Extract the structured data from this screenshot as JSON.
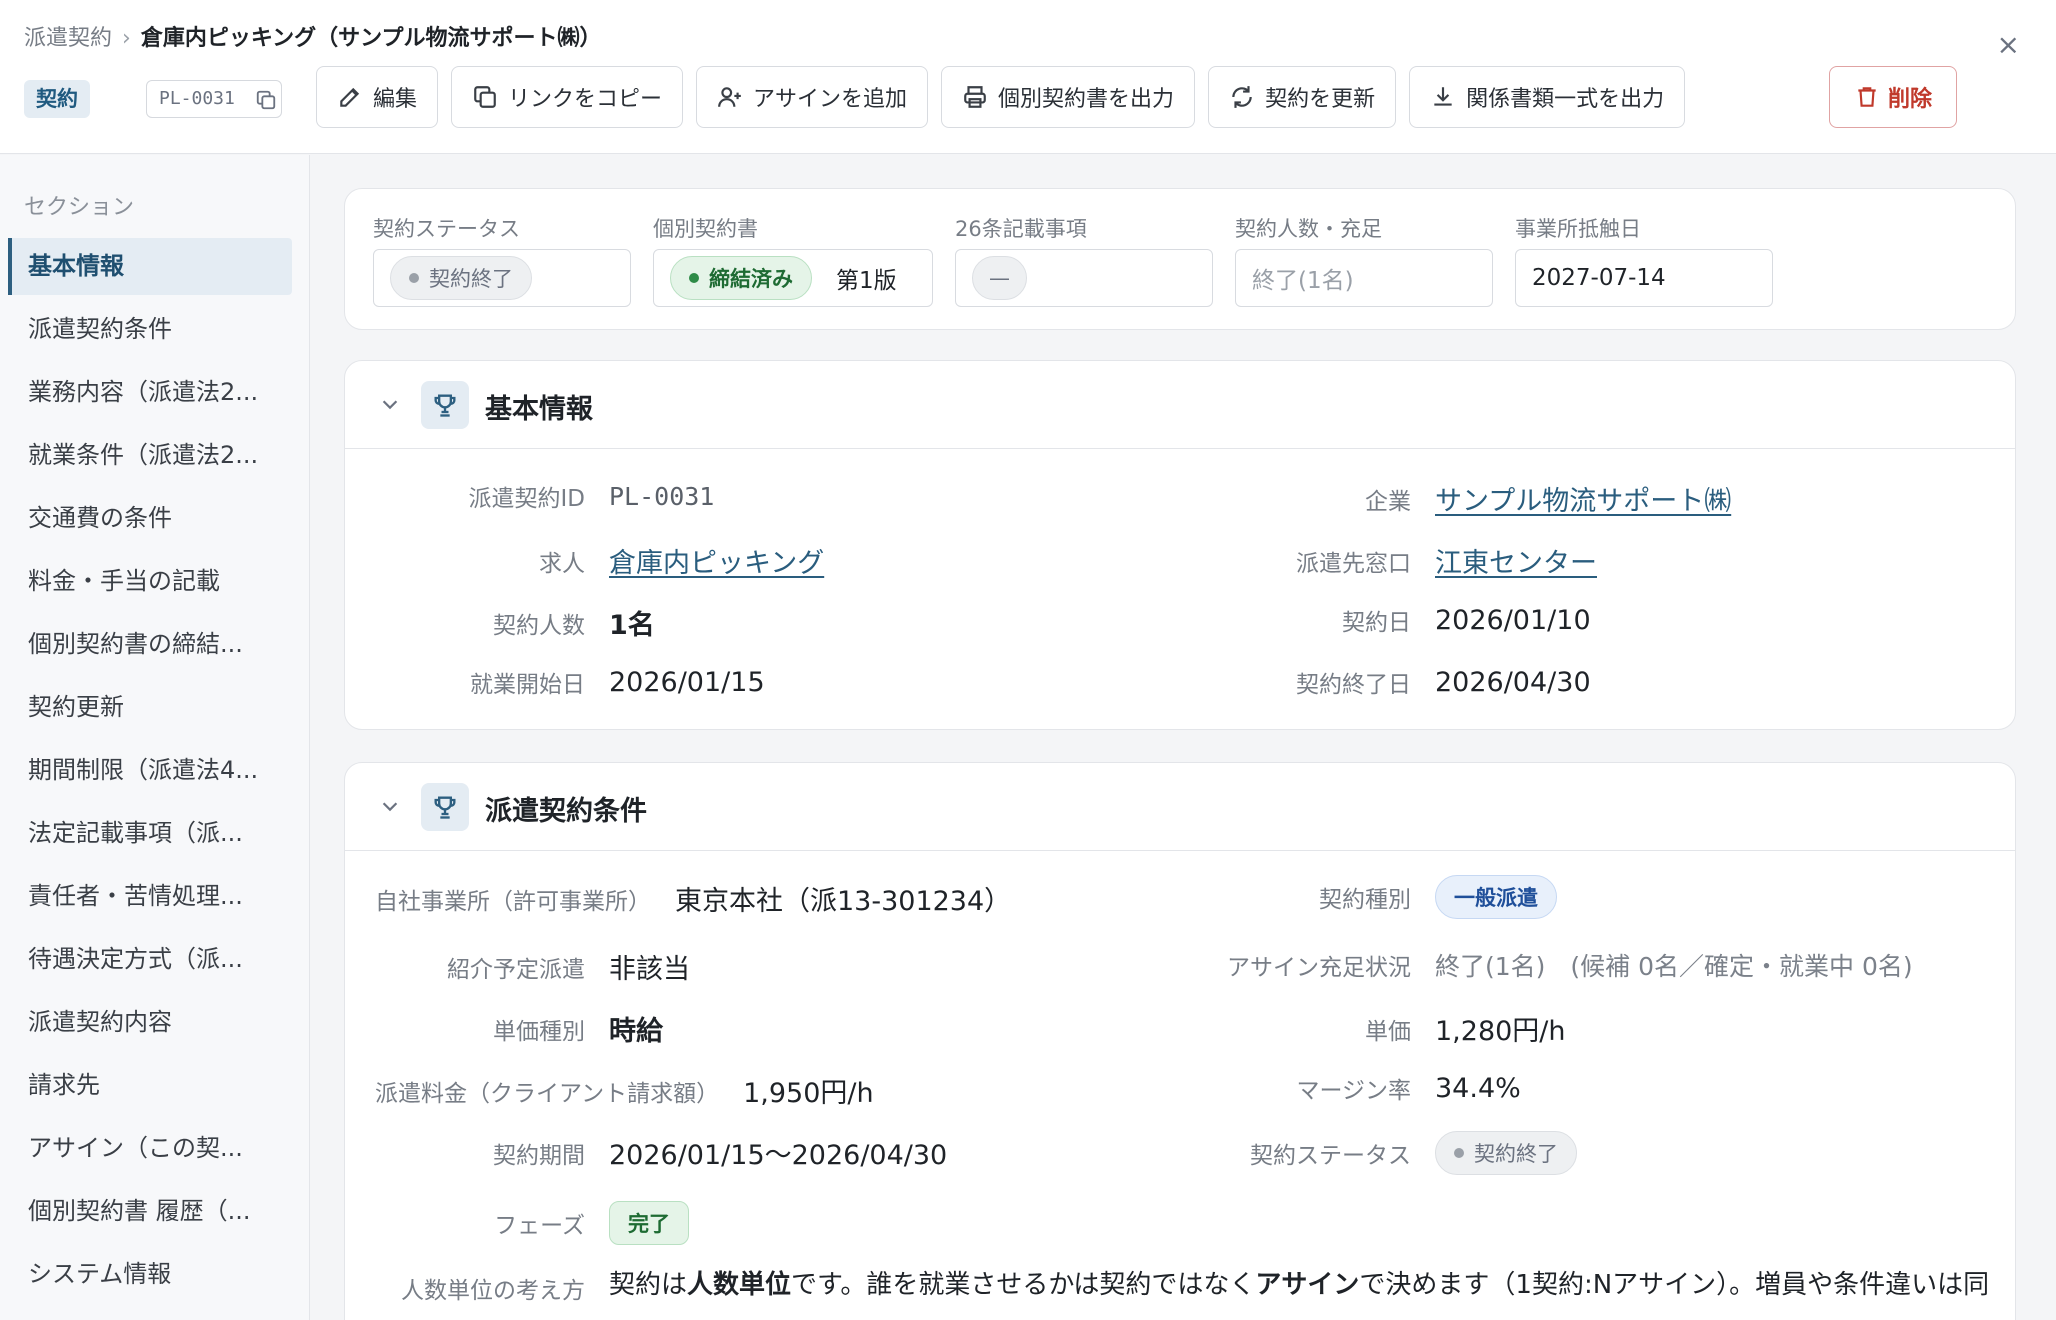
{
  "header": {
    "breadcrumb_parent": "派遣契約",
    "breadcrumb_separator": "›",
    "breadcrumb_current": "倉庫内ピッキング（サンプル物流サポート㈱）",
    "type_badge": "契約",
    "contract_id": "PL-0031",
    "close_glyph": "×",
    "actions": {
      "edit": "編集",
      "copy_link": "リンクをコピー",
      "add_assign": "アサインを追加",
      "export_individual": "個別契約書を出力",
      "renew": "契約を更新",
      "export_all": "関係書類一式を出力",
      "delete": "削除"
    },
    "colors": {
      "accent": "#2d5f80",
      "danger": "#c0392b"
    }
  },
  "sidebar": {
    "title": "セクション",
    "items": [
      "基本情報",
      "派遣契約条件",
      "業務内容（派遣法2...",
      "就業条件（派遣法2...",
      "交通費の条件",
      "料金・手当の記載",
      "個別契約書の締結...",
      "契約更新",
      "期間制限（派遣法4...",
      "法定記載事項（派...",
      "責任者・苦情処理...",
      "待遇決定方式（派...",
      "派遣契約内容",
      "請求先",
      "アサイン（この契...",
      "個別契約書 履歴（...",
      "システム情報"
    ]
  },
  "status": {
    "contract_status_label": "契約ステータス",
    "contract_status_value": "契約終了",
    "individual_label": "個別契約書",
    "individual_value": "締結済み",
    "individual_version": "第1版",
    "art26_label": "26条記載事項",
    "art26_value": "—",
    "headcount_label": "契約人数・充足",
    "headcount_placeholder": "終了(1名)",
    "conflict_label": "事業所抵触日",
    "conflict_value": "2027-07-14"
  },
  "basic": {
    "title": "基本情報",
    "contract_id_label": "派遣契約ID",
    "contract_id_value": "PL-0031",
    "company_label": "企業",
    "company_value": "サンプル物流サポート㈱",
    "job_label": "求人",
    "job_value": "倉庫内ピッキング",
    "contact_label": "派遣先窓口",
    "contact_value": "江東センター",
    "headcount_label": "契約人数",
    "headcount_value": "1名",
    "contract_date_label": "契約日",
    "contract_date_value": "2026/01/10",
    "start_label": "就業開始日",
    "start_value": "2026/01/15",
    "end_label": "契約終了日",
    "end_value": "2026/04/30"
  },
  "terms": {
    "title": "派遣契約条件",
    "office_label": "自社事業所（許可事業所）",
    "office_value": "東京本社（派13-301234）",
    "type_label": "契約種別",
    "type_value": "一般派遣",
    "referral_label": "紹介予定派遣",
    "referral_value": "非該当",
    "assign_label": "アサイン充足状況",
    "assign_value": "終了(1名)　(候補 0名／確定・就業中 0名)",
    "price_type_label": "単価種別",
    "price_type_value": "時給",
    "unit_price_label": "単価",
    "unit_price_value": "1,280円/h",
    "fee_label": "派遣料金（クライアント請求額）",
    "fee_value": "1,950円/h",
    "margin_label": "マージン率",
    "margin_value": "34.4%",
    "period_label": "契約期間",
    "period_value": "2026/01/15〜2026/04/30",
    "status_label": "契約ステータス",
    "status_value": "契約終了",
    "phase_label": "フェーズ",
    "phase_value": "完了",
    "headcount_rule_label": "人数単位の考え方",
    "headcount_rule_p1": "契約は",
    "headcount_rule_b1": "人数単位",
    "headcount_rule_p2": "です。誰を就業させるかは契約ではなく",
    "headcount_rule_b2": "アサイン",
    "headcount_rule_p3": "で決めます（1契約:Nアサイン）。増員や条件違いは同"
  }
}
